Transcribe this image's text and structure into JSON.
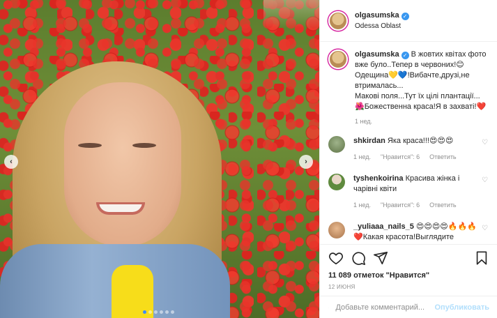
{
  "post": {
    "username": "olgasumska",
    "location": "Odessa Oblast",
    "caption_lines": [
      "В жовтих квітах фото вже було..Тепер в червоних!😊",
      "Одещина💛💙!Вибачте,друзі,не втрималась...",
      "Макові поля...Тут їх цілі плантації...",
      "🌺Божественна краса!Я в захваті!❤️"
    ],
    "caption_time": "1 нед.",
    "likes": "11 089 отметок \"Нравится\"",
    "date": "12 ИЮНЯ"
  },
  "comments": [
    {
      "user": "shkirdan",
      "text": "Яка краса!!!😍😍😍",
      "time": "1 нед.",
      "likes": "\"Нравится\": 6",
      "reply": "Ответить"
    },
    {
      "user": "tyshenkoirina",
      "text": "Красива жінка і чарівні квіти",
      "time": "1 нед.",
      "likes": "\"Нравится\": 6",
      "reply": "Ответить"
    },
    {
      "user": "_yuliaaa_nails_5",
      "text": "😍😍😍😍🔥🔥🔥 ❤️Какая красота!Выглядите",
      "time": "",
      "likes": "",
      "reply": ""
    }
  ],
  "composer": {
    "placeholder": "Добавьте комментарий...",
    "publish": "Опубликовать"
  },
  "carousel": {
    "total": 6,
    "active_index": 0
  },
  "colors": {
    "accent": "#3897f0",
    "publish_disabled": "#b2dffc",
    "muted": "#8e8e8e"
  },
  "icons": [
    "chevron-left-icon",
    "chevron-right-icon",
    "heart-icon",
    "comment-icon",
    "share-icon",
    "bookmark-icon",
    "emoji-icon",
    "verified-icon"
  ]
}
